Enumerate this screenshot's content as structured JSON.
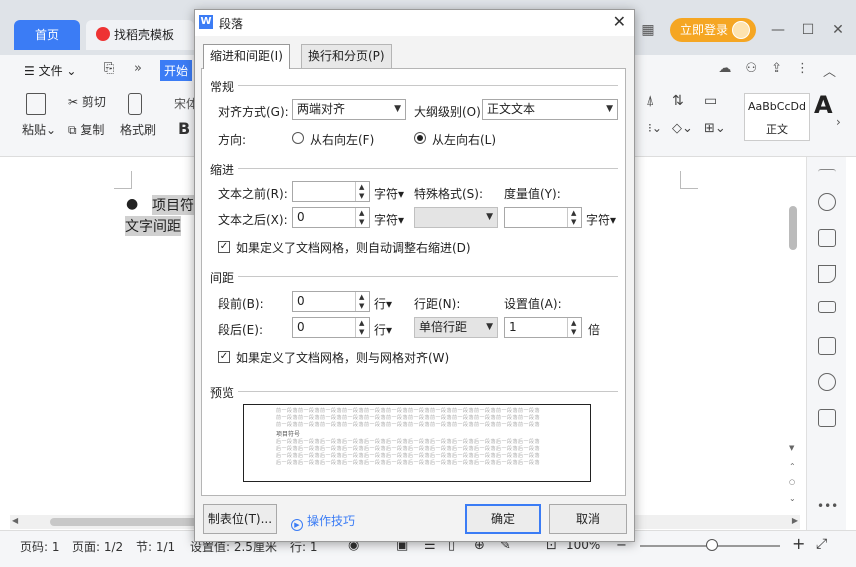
{
  "app": {
    "tabs": [
      {
        "label": "首页"
      },
      {
        "label": "找稻壳模板"
      }
    ],
    "login_label": "立即登录"
  },
  "menubar": {
    "file_label": "文件",
    "start_label": "开始"
  },
  "ribbon": {
    "paste_label": "粘贴",
    "cut_label": "剪切",
    "copy_label": "复制",
    "format_painter_label": "格式刷",
    "font_partial": "宋体",
    "bold_label": "B",
    "style_preview": "AaBbCcDd",
    "style_name": "正文",
    "big_a": "A"
  },
  "document": {
    "bullet": "●",
    "line1": "项目符",
    "line2": "文字间距"
  },
  "statusbar": {
    "page_num": "页码: 1",
    "page_count": "页面: 1/2",
    "section": "节: 1/1",
    "setting": "设置值: 2.5厘米",
    "row": "行: 1",
    "zoom": "100%"
  },
  "dialog": {
    "title": "段落",
    "tabs": [
      {
        "label": "缩进和间距(I)"
      },
      {
        "label": "换行和分页(P)"
      }
    ],
    "general": {
      "section_label": "常规",
      "alignment_label": "对齐方式(G):",
      "alignment_value": "两端对齐",
      "outline_label": "大纲级别(O):",
      "outline_value": "正文文本",
      "direction_label": "方向:",
      "rtl_label": "从右向左(F)",
      "ltr_label": "从左向右(L)"
    },
    "indent": {
      "section_label": "缩进",
      "before_label": "文本之前(R):",
      "before_value": "",
      "before_unit": "字符",
      "special_label": "特殊格式(S):",
      "special_value": "",
      "measure_label": "度量值(Y):",
      "measure_value": "",
      "measure_unit": "字符",
      "after_label": "文本之后(X):",
      "after_value": "0",
      "after_unit": "字符",
      "auto_adjust_label": "如果定义了文档网格，则自动调整右缩进(D)"
    },
    "spacing": {
      "section_label": "间距",
      "before_label": "段前(B):",
      "before_value": "0",
      "before_unit": "行",
      "line_spacing_label": "行距(N):",
      "line_spacing_value": "单倍行距",
      "setting_label": "设置值(A):",
      "setting_value": "1",
      "setting_unit": "倍",
      "after_label": "段后(E):",
      "after_value": "0",
      "after_unit": "行",
      "snap_grid_label": "如果定义了文档网格，则与网格对齐(W)"
    },
    "preview": {
      "section_label": "预览",
      "prev_text": "前一段落前一段落前一段落前一段落前一段落前一段落前一段落前一段落前一段落前一段落前一段落前一段落",
      "sample_text": "项目符号",
      "next_text": "后一段落后一段落后一段落后一段落后一段落后一段落后一段落后一段落后一段落后一段落后一段落后一段落"
    },
    "buttons": {
      "tabs_label": "制表位(T)...",
      "tips_label": "操作技巧",
      "ok_label": "确定",
      "cancel_label": "取消"
    }
  }
}
